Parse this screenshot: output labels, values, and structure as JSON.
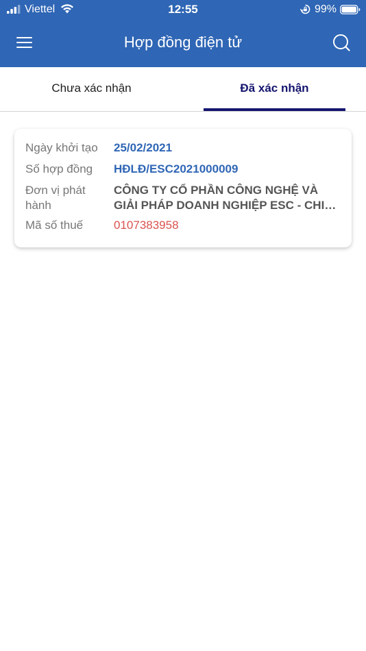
{
  "status_bar": {
    "carrier": "Viettel",
    "time": "12:55",
    "battery_percent": "99%"
  },
  "app_bar": {
    "title": "Hợp đồng điện tử"
  },
  "tabs": [
    {
      "label": "Chưa xác nhận",
      "active": false
    },
    {
      "label": "Đã xác nhận",
      "active": true
    }
  ],
  "contracts": [
    {
      "created_date_label": "Ngày khởi tạo",
      "created_date": "25/02/2021",
      "contract_number_label": "Số hợp đồng",
      "contract_number": "HĐLĐ/ESC2021000009",
      "issuer_label": "Đơn vị phát hành",
      "issuer": "CÔNG TY CỔ PHẦN CÔNG NGHỆ VÀ GIẢI PHÁP DOANH NGHIỆP ESC - CHI NHÁNH",
      "tax_code_label": "Mã số thuế",
      "tax_code": "0107383958"
    }
  ],
  "colors": {
    "header_blue": "#2f66b5",
    "active_tab": "#15156e",
    "tax_red": "#d9534f"
  }
}
